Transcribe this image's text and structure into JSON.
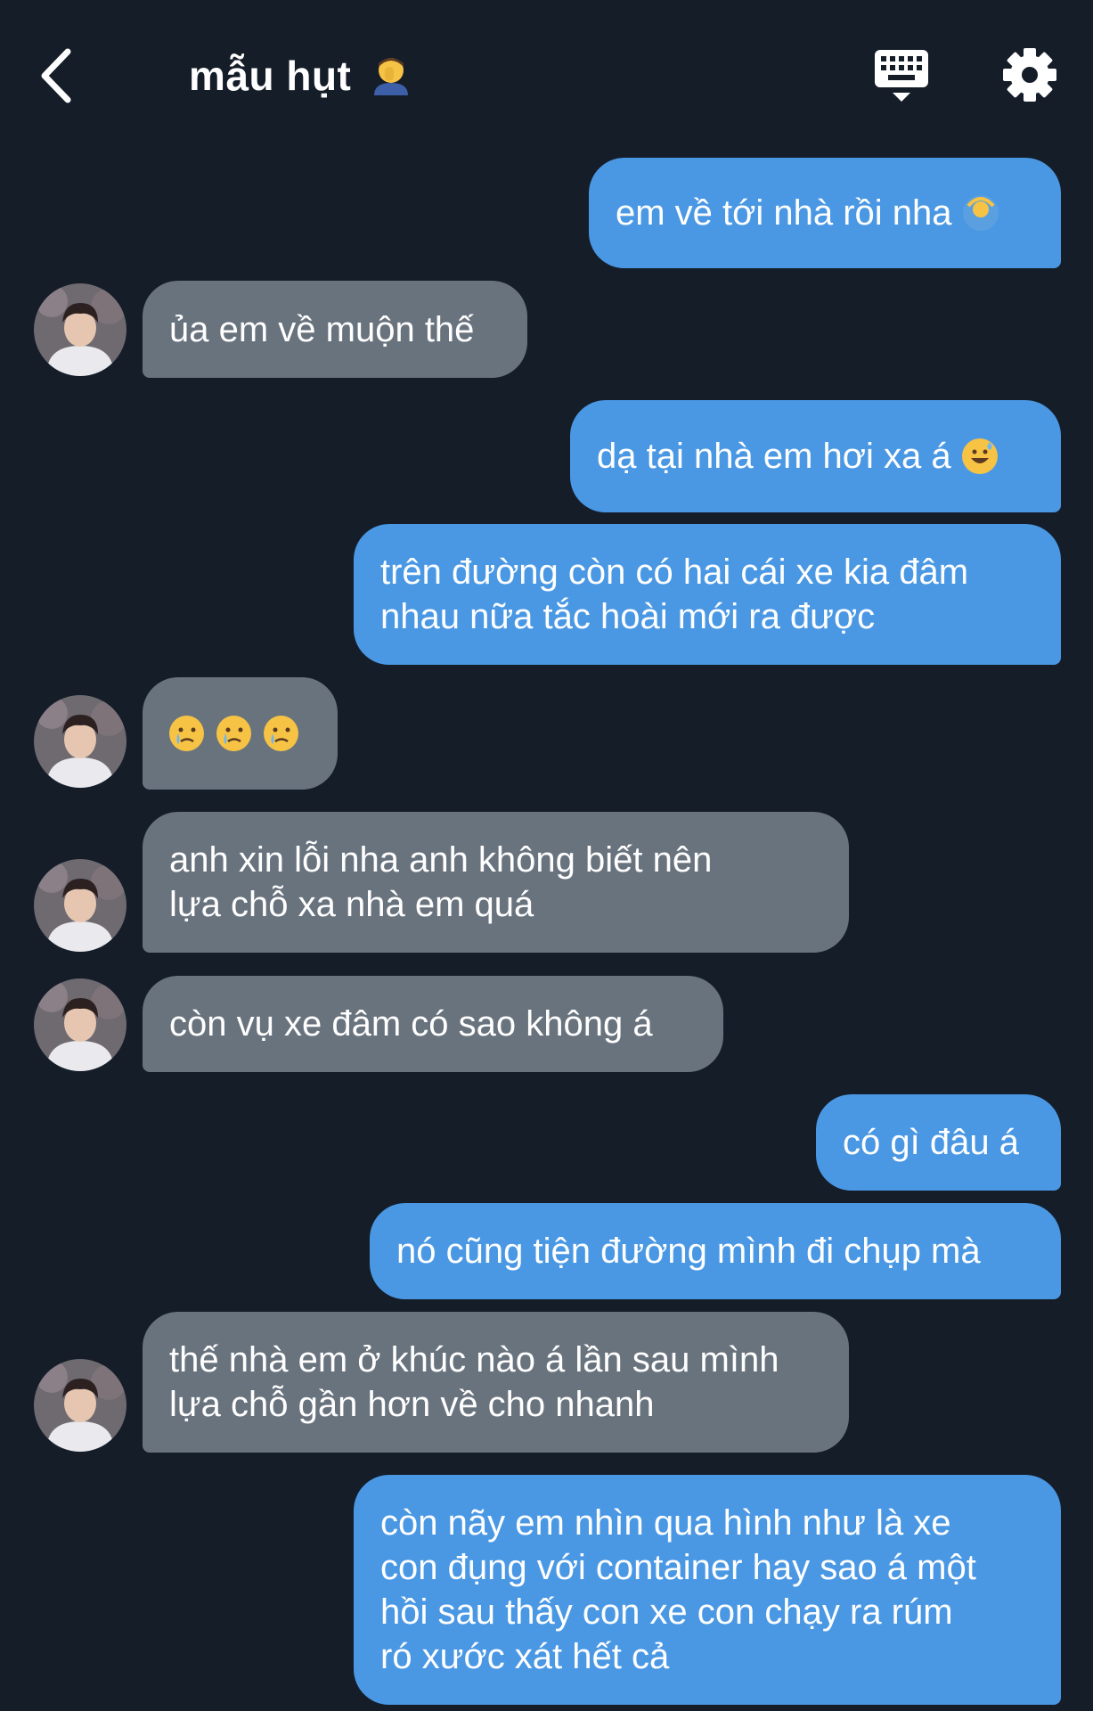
{
  "header": {
    "title": "mẫu hụt",
    "title_emoji": "man-facepalming-emoji"
  },
  "colors": {
    "background": "#151d29",
    "sent_bubble": "#4a98e4",
    "received_bubble": "#69737e",
    "text": "#ffffff"
  },
  "messages": [
    {
      "from": "me",
      "text": "em về tới nhà rồi nha",
      "emoji": "woman-gesturing-ok-emoji"
    },
    {
      "from": "them",
      "text": "ủa em về muộn thế"
    },
    {
      "from": "me",
      "text": "dạ tại nhà em hơi xa á",
      "emoji": "grinning-sweat-emoji"
    },
    {
      "from": "me",
      "text": "trên đường còn có hai cái xe kia đâm\nnhau nữa tắc hoài mới ra được"
    },
    {
      "from": "them",
      "text": "",
      "emojis": [
        "crying-face-emoji",
        "crying-face-emoji",
        "crying-face-emoji"
      ]
    },
    {
      "from": "them",
      "text": "anh xin lỗi nha anh không biết nên\nlựa chỗ xa nhà em quá"
    },
    {
      "from": "them",
      "text": "còn vụ xe đâm có sao không á"
    },
    {
      "from": "me",
      "text": "có gì đâu á"
    },
    {
      "from": "me",
      "text": "nó cũng tiện đường mình đi chụp mà"
    },
    {
      "from": "them",
      "text": "thế nhà em ở khúc nào á lần sau mình\nlựa chỗ gần hơn về cho nhanh"
    },
    {
      "from": "me",
      "text": "còn nãy em nhìn qua hình như là xe\ncon đụng với container hay sao á một\nhồi sau thấy con xe con chạy ra rúm\nró xước xát hết cả"
    }
  ]
}
